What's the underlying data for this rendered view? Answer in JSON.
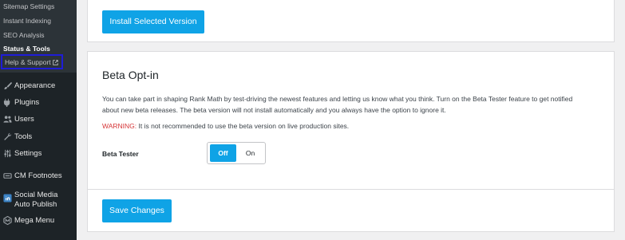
{
  "sidebar": {
    "submenu": [
      {
        "label": "Sitemap Settings"
      },
      {
        "label": "Instant Indexing"
      },
      {
        "label": "SEO Analysis"
      },
      {
        "label": "Status & Tools"
      }
    ],
    "help_label": "Help & Support",
    "menu": [
      {
        "label": "Appearance",
        "icon": "paintbrush-icon"
      },
      {
        "label": "Plugins",
        "icon": "plug-icon"
      },
      {
        "label": "Users",
        "icon": "users-icon"
      },
      {
        "label": "Tools",
        "icon": "wrench-icon"
      },
      {
        "label": "Settings",
        "icon": "sliders-icon"
      },
      {
        "label": "CM Footnotes",
        "icon": "cm-footnotes-icon"
      },
      {
        "label": "Social Media Auto Publish",
        "icon": "social-media-icon"
      },
      {
        "label": "Mega Menu",
        "icon": "mega-menu-icon"
      }
    ]
  },
  "top_card": {
    "install_button": "Install Selected Version"
  },
  "beta": {
    "title": "Beta Opt-in",
    "description": "You can take part in shaping Rank Math by test-driving the newest features and letting us know what you think. Turn on the Beta Tester feature to get notified about new beta releases. The beta version will not install automatically and you always have the option to ignore it.",
    "warning_label": "WARNING:",
    "warning_text": "It is not recommended to use the beta version on live production sites.",
    "field_label": "Beta Tester",
    "toggle_off": "Off",
    "toggle_on": "On",
    "toggle_selected": "Off"
  },
  "footer": {
    "save_button": "Save Changes"
  },
  "colors": {
    "accent": "#0fa3e6",
    "sidebar_bg": "#1d2327",
    "warning": "#d63638",
    "highlight_box": "#1f1dd6"
  }
}
